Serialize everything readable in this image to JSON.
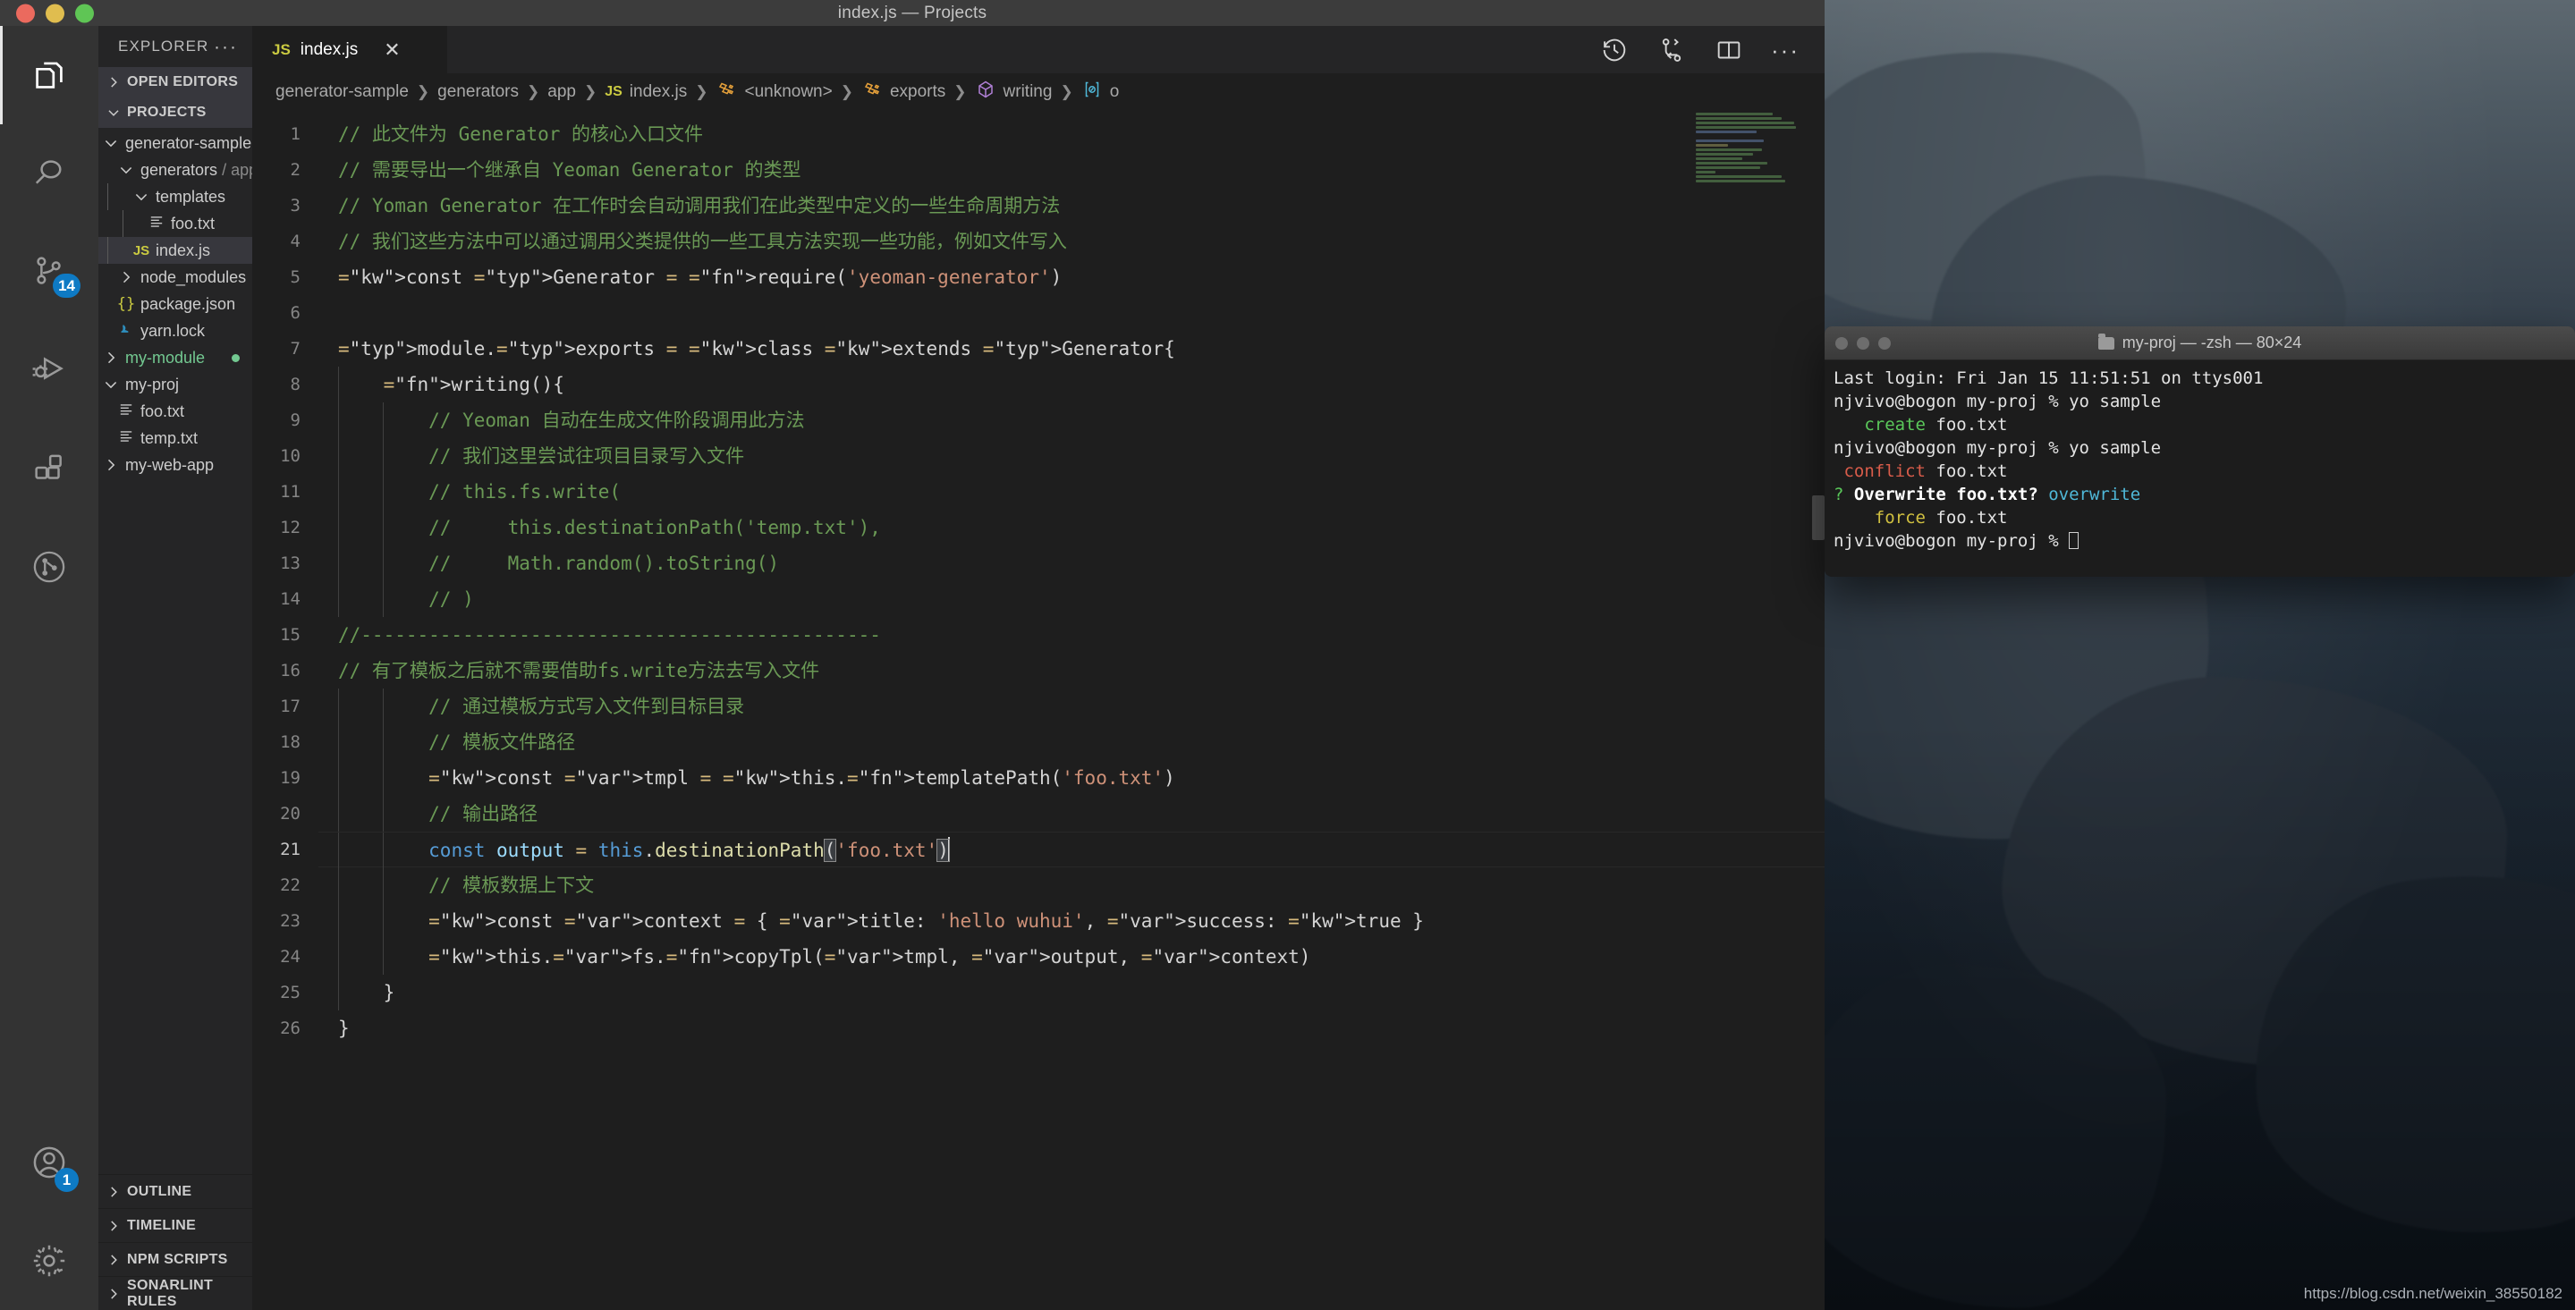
{
  "window": {
    "title": "index.js — Projects",
    "traffic_lights": [
      "close-red",
      "minimize-yellow",
      "zoom-green"
    ]
  },
  "activity_bar": {
    "items": [
      {
        "name": "explorer",
        "icon": "files-icon",
        "active": true,
        "badge": ""
      },
      {
        "name": "search",
        "icon": "search-icon",
        "active": false,
        "badge": ""
      },
      {
        "name": "source-control",
        "icon": "source-control-icon",
        "active": false,
        "badge": "14"
      },
      {
        "name": "run-and-debug",
        "icon": "run-debug-icon",
        "active": false,
        "badge": ""
      },
      {
        "name": "extensions",
        "icon": "extensions-icon",
        "active": false,
        "badge": ""
      },
      {
        "name": "gitlens",
        "icon": "gitlens-icon",
        "active": false,
        "badge": ""
      },
      {
        "name": "accounts",
        "icon": "account-icon",
        "active": false,
        "badge": "1"
      },
      {
        "name": "manage",
        "icon": "gear-icon",
        "active": false,
        "badge": ""
      }
    ]
  },
  "sidebar": {
    "header_title": "EXPLORER",
    "more_actions": "···",
    "sections": [
      {
        "label": "OPEN EDITORS",
        "expanded": false
      },
      {
        "label": "PROJECTS",
        "expanded": true
      }
    ],
    "tree": [
      {
        "label": "generator-sample",
        "suffix": "",
        "icon": "chevron-down-icon",
        "indent": 1,
        "type": "folder",
        "selected": false,
        "modified": false
      },
      {
        "label": "generators",
        "suffix": " / app",
        "icon": "chevron-down-icon",
        "indent": 2,
        "type": "folder",
        "selected": false,
        "modified": false
      },
      {
        "label": "templates",
        "suffix": "",
        "icon": "chevron-down-icon",
        "indent": 3,
        "type": "folder",
        "selected": false,
        "modified": false
      },
      {
        "label": "foo.txt",
        "suffix": "",
        "icon": "text-file-icon",
        "indent": 4,
        "type": "file",
        "selected": false,
        "modified": false
      },
      {
        "label": "index.js",
        "suffix": "",
        "icon": "js-file-icon",
        "indent": 3,
        "type": "file",
        "selected": true,
        "modified": false
      },
      {
        "label": "node_modules",
        "suffix": "",
        "icon": "chevron-right-icon",
        "indent": 2,
        "type": "folder",
        "selected": false,
        "modified": false
      },
      {
        "label": "package.json",
        "suffix": "",
        "icon": "json-file-icon",
        "indent": 2,
        "type": "file",
        "selected": false,
        "modified": false
      },
      {
        "label": "yarn.lock",
        "suffix": "",
        "icon": "yarn-file-icon",
        "indent": 2,
        "type": "file",
        "selected": false,
        "modified": false
      },
      {
        "label": "my-module",
        "suffix": "",
        "icon": "chevron-right-icon",
        "indent": 1,
        "type": "folder",
        "selected": false,
        "modified": true
      },
      {
        "label": "my-proj",
        "suffix": "",
        "icon": "chevron-down-icon",
        "indent": 1,
        "type": "folder",
        "selected": false,
        "modified": false
      },
      {
        "label": "foo.txt",
        "suffix": "",
        "icon": "text-file-icon",
        "indent": 2,
        "type": "file",
        "selected": false,
        "modified": false
      },
      {
        "label": "temp.txt",
        "suffix": "",
        "icon": "text-file-icon",
        "indent": 2,
        "type": "file",
        "selected": false,
        "modified": false
      },
      {
        "label": "my-web-app",
        "suffix": "",
        "icon": "chevron-right-icon",
        "indent": 1,
        "type": "folder",
        "selected": false,
        "modified": false
      }
    ],
    "bottom_sections": [
      {
        "label": "OUTLINE"
      },
      {
        "label": "TIMELINE"
      },
      {
        "label": "NPM SCRIPTS"
      },
      {
        "label": "SONARLINT RULES"
      }
    ]
  },
  "editor": {
    "tab": {
      "label": "index.js",
      "badge": "JS",
      "close": "✕"
    },
    "actions": [
      {
        "name": "timeline-history-icon"
      },
      {
        "name": "compare-changes-icon"
      },
      {
        "name": "split-editor-icon"
      },
      {
        "name": "more-actions-icon",
        "label": "···"
      }
    ],
    "breadcrumbs": [
      {
        "label": "generator-sample",
        "icon": ""
      },
      {
        "label": "generators",
        "icon": ""
      },
      {
        "label": "app",
        "icon": ""
      },
      {
        "label": "index.js",
        "icon": "js-icon"
      },
      {
        "label": "<unknown>",
        "icon": "symbol-field-icon"
      },
      {
        "label": "exports",
        "icon": "symbol-field-icon"
      },
      {
        "label": "writing",
        "icon": "symbol-method-icon"
      },
      {
        "label": "o",
        "icon": "symbol-variable-icon"
      }
    ],
    "line_numbers": [
      1,
      2,
      3,
      4,
      5,
      6,
      7,
      8,
      9,
      10,
      11,
      12,
      13,
      14,
      15,
      16,
      17,
      18,
      19,
      20,
      21,
      22,
      23,
      24,
      25,
      26
    ],
    "current_line": 21,
    "lines": [
      "// 此文件为 Generator 的核心入口文件",
      "// 需要导出一个继承自 Yeoman Generator 的类型",
      "// Yoman Generator 在工作时会自动调用我们在此类型中定义的一些生命周期方法",
      "// 我们这些方法中可以通过调用父类提供的一些工具方法实现一些功能，例如文件写入",
      "const Generator = require('yeoman-generator')",
      "",
      "module.exports = class extends Generator{",
      "    writing(){",
      "        // Yeoman 自动在生成文件阶段调用此方法",
      "        // 我们这里尝试往项目目录写入文件",
      "        // this.fs.write(",
      "        //     this.destinationPath('temp.txt'),",
      "        //     Math.random().toString()",
      "        // )",
      "//----------------------------------------------",
      "// 有了模板之后就不需要借助fs.write方法去写入文件",
      "        // 通过模板方式写入文件到目标目录",
      "        // 模板文件路径",
      "        const tmpl = this.templatePath('foo.txt')",
      "        // 输出路径",
      "        const output = this.destinationPath('foo.txt')",
      "        // 模板数据上下文",
      "        const context = { title: 'hello wuhui', success: true }",
      "        this.fs.copyTpl(tmpl, output, context)",
      "    }",
      "}"
    ]
  },
  "terminal": {
    "title": "my-proj — -zsh — 80×24",
    "lines": [
      {
        "segments": [
          {
            "t": "Last login: Fri Jan 15 11:51:51 on ttys001",
            "c": ""
          }
        ]
      },
      {
        "segments": [
          {
            "t": "njvivo@bogon my-proj % yo sample",
            "c": ""
          }
        ]
      },
      {
        "segments": [
          {
            "t": "   create ",
            "c": "t-green"
          },
          {
            "t": "foo.txt",
            "c": ""
          }
        ]
      },
      {
        "segments": [
          {
            "t": "njvivo@bogon my-proj % yo sample",
            "c": ""
          }
        ]
      },
      {
        "segments": [
          {
            "t": " conflict ",
            "c": "t-red"
          },
          {
            "t": "foo.txt",
            "c": ""
          }
        ]
      },
      {
        "segments": [
          {
            "t": "? ",
            "c": "t-green"
          },
          {
            "t": "Overwrite foo.txt? ",
            "c": "t-bold"
          },
          {
            "t": "overwrite",
            "c": "t-cyan"
          }
        ]
      },
      {
        "segments": [
          {
            "t": "    force ",
            "c": "t-yellow"
          },
          {
            "t": "foo.txt",
            "c": ""
          }
        ]
      },
      {
        "segments": [
          {
            "t": "njvivo@bogon my-proj % ",
            "c": ""
          }
        ],
        "caret": true
      }
    ]
  },
  "desktop": {
    "watermark": "https://blog.csdn.net/weixin_38550182"
  },
  "colors": {
    "accent_blue": "#0e7ac4",
    "js_yellow": "#cbcb41",
    "git_modified_green": "#73c991",
    "editor_bg": "#1e1e1e",
    "sidebar_bg": "#252526",
    "activitybar_bg": "#333333",
    "titlebar_bg": "#3c3c3c"
  }
}
